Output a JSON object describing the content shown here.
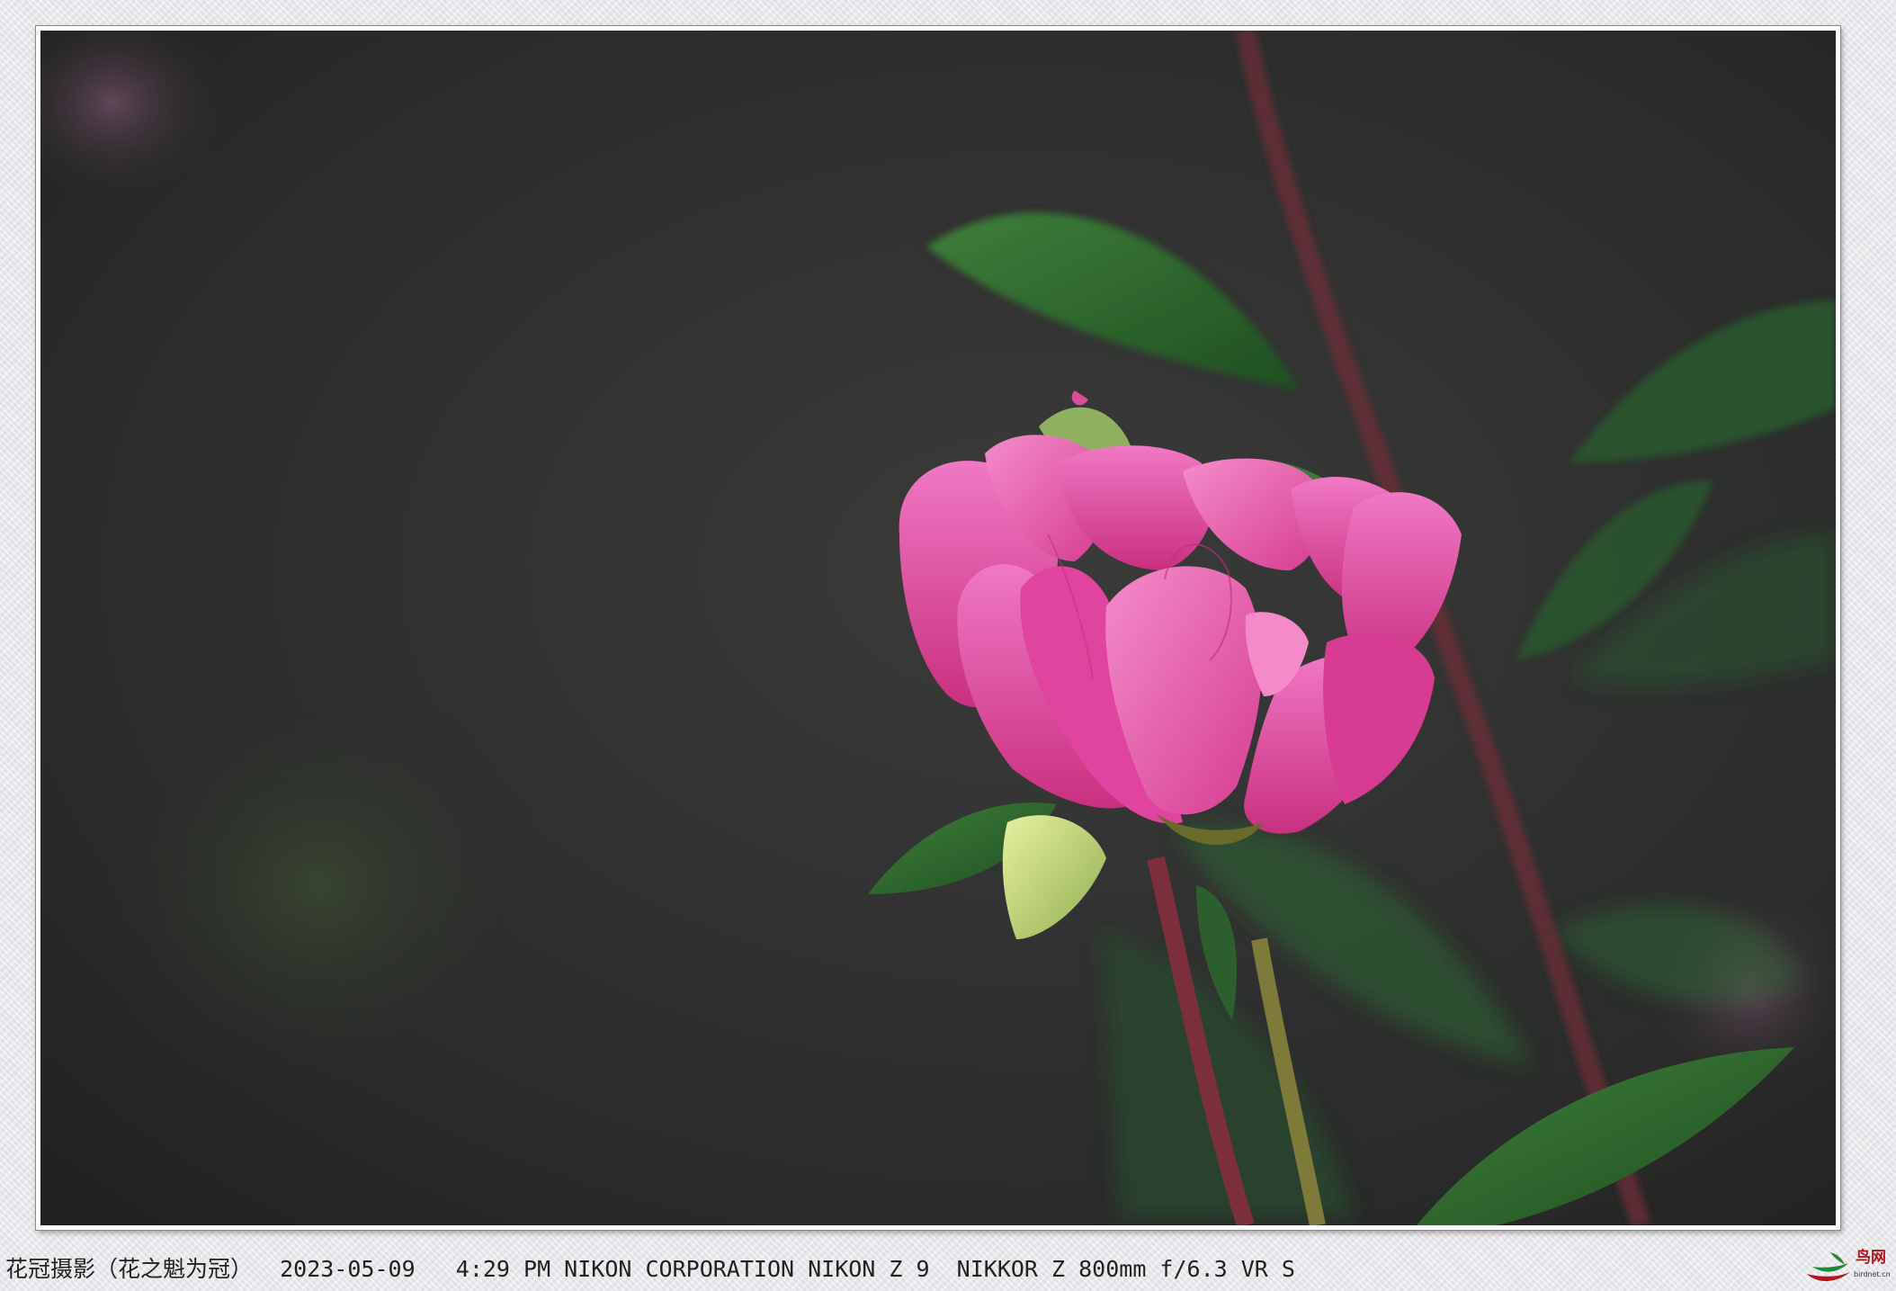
{
  "caption": {
    "text": "花冠摄影（花之魁为冠）  2023-05-09   4:29 PM NIKON CORPORATION NIKON Z 9  NIKKOR Z 800mm f/6.3 VR S"
  },
  "watermark": {
    "name": "鸟网",
    "site": "birdnet.cn"
  },
  "colors": {
    "background": "#2b2c2b",
    "petal": "#e0449e",
    "petal_light": "#f07fc4",
    "leaf": "#2f6b30",
    "stem": "#7a2f3a",
    "logo_red": "#b0161c",
    "logo_green": "#1c8a3a"
  }
}
